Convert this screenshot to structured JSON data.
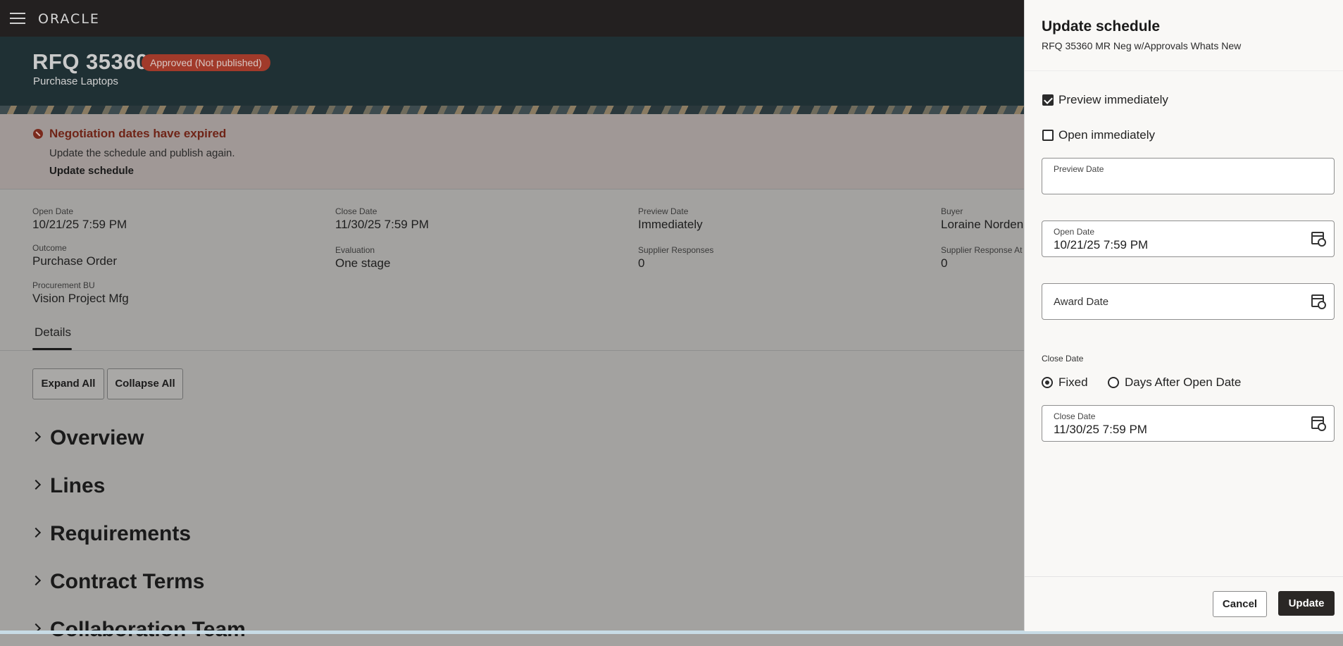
{
  "header": {
    "logo": "ORACLE"
  },
  "rfq": {
    "title": "RFQ 35360",
    "status": "Approved (Not published)",
    "subtitle": "Purchase Laptops"
  },
  "alert": {
    "title": "Negotiation dates have expired",
    "message": "Update the schedule and publish again.",
    "link": "Update schedule"
  },
  "details": {
    "open_date": {
      "label": "Open Date",
      "value": "10/21/25 7:59 PM"
    },
    "close_date": {
      "label": "Close Date",
      "value": "11/30/25 7:59 PM"
    },
    "preview_date": {
      "label": "Preview Date",
      "value": "Immediately"
    },
    "buyer": {
      "label": "Buyer",
      "value": "Loraine Norden"
    },
    "outcome": {
      "label": "Outcome",
      "value": "Purchase Order"
    },
    "evaluation": {
      "label": "Evaluation",
      "value": "One stage"
    },
    "supplier_responses": {
      "label": "Supplier Responses",
      "value": "0"
    },
    "supplier_response_at": {
      "label": "Supplier Response At",
      "value": "0"
    },
    "procurement_bu": {
      "label": "Procurement BU",
      "value": "Vision Project Mfg"
    }
  },
  "tabs": {
    "details": "Details"
  },
  "actions": {
    "expand_all": "Expand All",
    "collapse_all": "Collapse All"
  },
  "sections": [
    "Overview",
    "Lines",
    "Requirements",
    "Contract Terms",
    "Collaboration Team"
  ],
  "panel": {
    "title": "Update schedule",
    "subtitle": "RFQ 35360 MR Neg w/Approvals Whats New",
    "preview_immediately": {
      "label": "Preview immediately",
      "checked": true
    },
    "open_immediately": {
      "label": "Open immediately",
      "checked": false
    },
    "preview_date": {
      "label": "Preview Date",
      "value": ""
    },
    "open_date": {
      "label": "Open Date",
      "value": "10/21/25 7:59 PM"
    },
    "award_date": {
      "label": "Award Date",
      "value": ""
    },
    "close_date_group": {
      "label": "Close Date",
      "option_fixed": "Fixed",
      "option_days": "Days After Open Date",
      "selected": "Fixed"
    },
    "close_date": {
      "label": "Close Date",
      "value": "11/30/25 7:59 PM"
    },
    "cancel": "Cancel",
    "update": "Update"
  }
}
